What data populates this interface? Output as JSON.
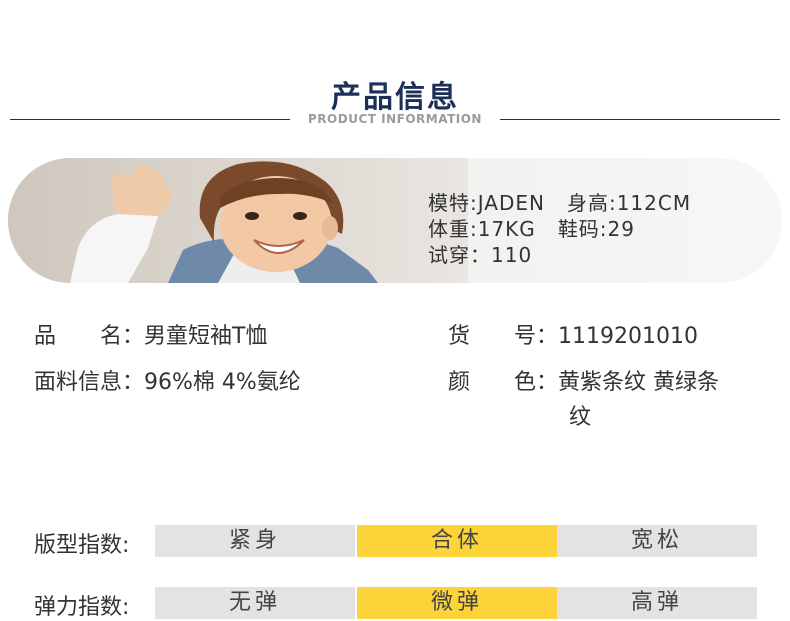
{
  "header": {
    "title": "产品信息",
    "subtitle": "PRODUCT INFORMATION"
  },
  "model": {
    "name_label": "模特:JADEN",
    "height_label": "身高:112CM",
    "weight_label": "体重:17KG",
    "shoe_label": "鞋码:29",
    "fit_label": "试穿：110"
  },
  "specs": {
    "name": {
      "label": "品　　名：",
      "value": "男童短袖T恤"
    },
    "item_no": {
      "label": "货　　号：",
      "value": "1119201010"
    },
    "fabric": {
      "label": "面料信息：",
      "value": "96%棉 4%氨纶"
    },
    "color": {
      "label": "颜　　色：",
      "value_line1": "黄紫条纹 黄绿条",
      "value_line2": "纹"
    }
  },
  "fit_index": {
    "label": "版型指数:",
    "options": [
      "紧身",
      "合体",
      "宽松"
    ],
    "selected": 1
  },
  "elastic_index": {
    "label": "弹力指数:",
    "options": [
      "无弹",
      "微弹",
      "高弹"
    ],
    "selected": 1
  },
  "colors": {
    "navy": "#1d2f58",
    "highlight": "#fdd33a",
    "cell_bg": "#e3e3e3"
  }
}
